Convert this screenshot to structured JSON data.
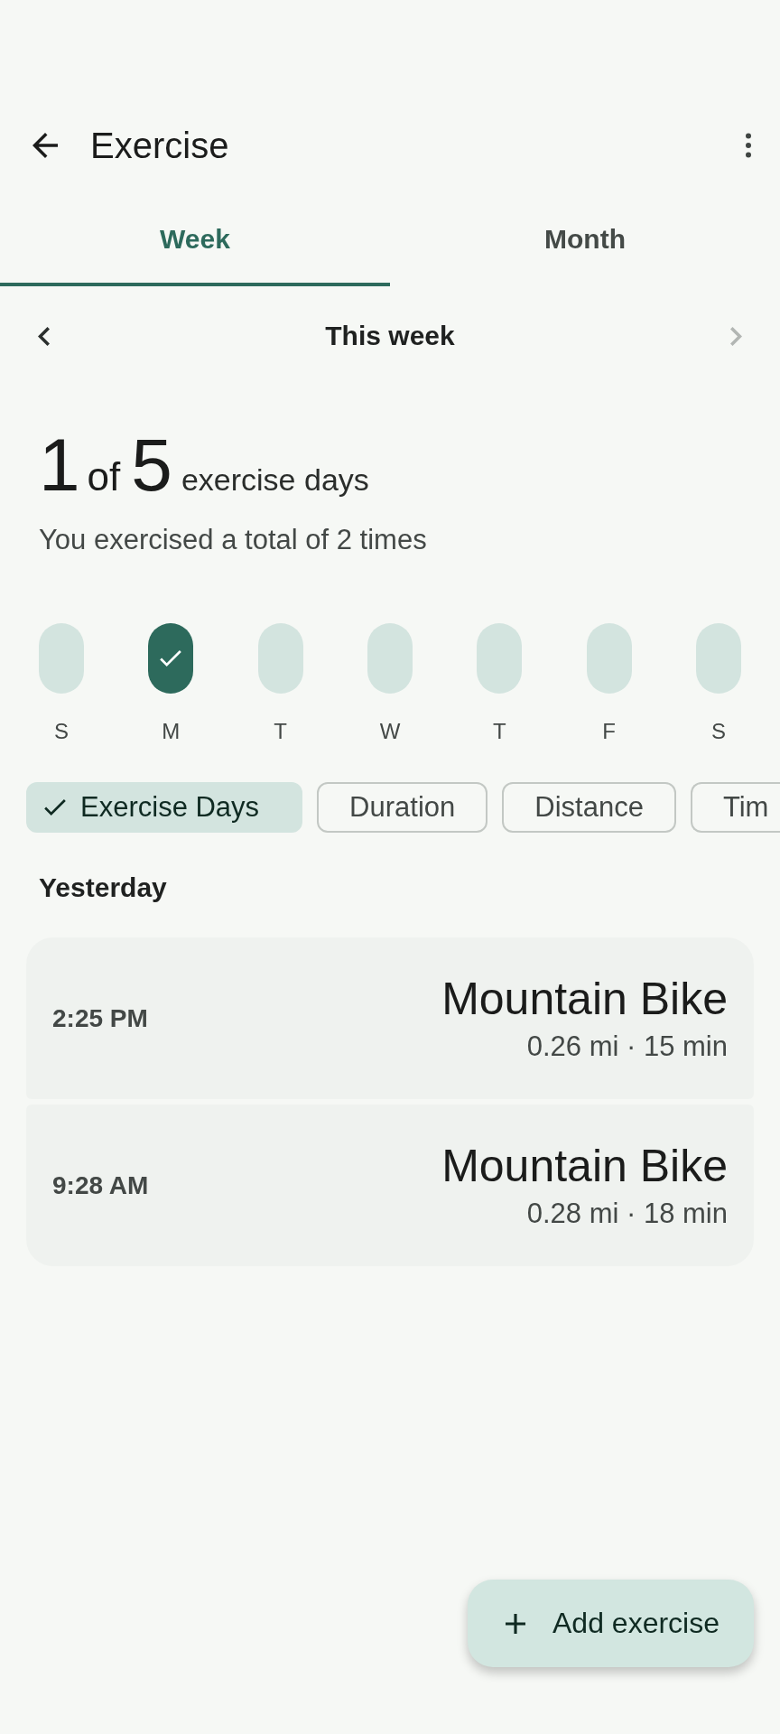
{
  "app_bar": {
    "title": "Exercise"
  },
  "tabs": [
    {
      "label": "Week",
      "selected": true
    },
    {
      "label": "Month",
      "selected": false
    }
  ],
  "period": {
    "label": "This week",
    "buttons": [
      {
        "kind": "previous",
        "disabled": false
      },
      {
        "kind": "next",
        "disabled": true
      }
    ]
  },
  "summary": {
    "done": "1",
    "connector": "of",
    "goal": "5",
    "unit": "exercise days",
    "detail": "You exercised a total of 2 times"
  },
  "days": [
    {
      "label": "S",
      "checked": false
    },
    {
      "label": "M",
      "checked": true
    },
    {
      "label": "T",
      "checked": false
    },
    {
      "label": "W",
      "checked": false
    },
    {
      "label": "T",
      "checked": false
    },
    {
      "label": "F",
      "checked": false
    },
    {
      "label": "S",
      "checked": false
    }
  ],
  "chips": [
    {
      "label": "Exercise Days",
      "selected": true
    },
    {
      "label": "Duration",
      "selected": false
    },
    {
      "label": "Distance",
      "selected": false
    },
    {
      "label": "Tim",
      "selected": false
    }
  ],
  "sections": [
    {
      "title": "Yesterday",
      "entries": [
        {
          "time": "2:25 PM",
          "activity": "Mountain Bike",
          "details": "0.26 mi · 15 min"
        },
        {
          "time": "9:28 AM",
          "activity": "Mountain Bike",
          "details": "0.28 mi · 18 min"
        }
      ]
    }
  ],
  "fab": {
    "label": "Add exercise"
  }
}
